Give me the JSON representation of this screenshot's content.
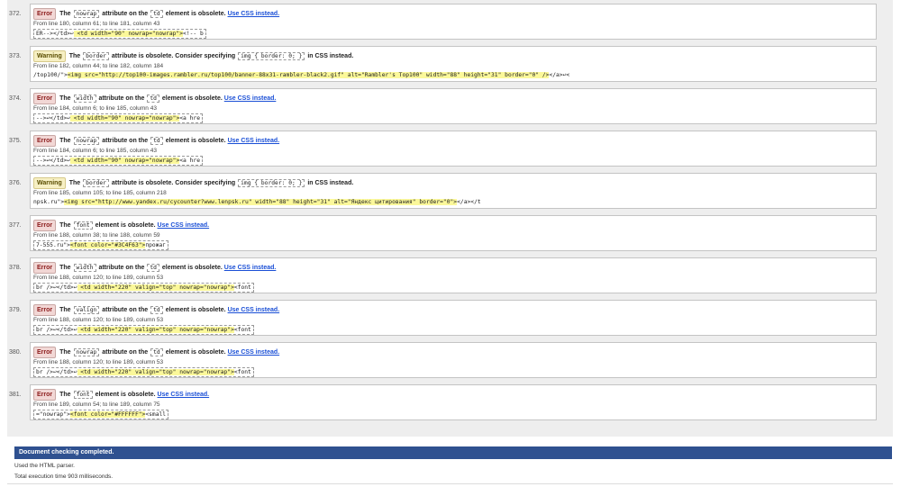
{
  "messages": [
    {
      "num": "372.",
      "type": "error",
      "badge": "Error",
      "pre": "The",
      "code1": "nowrap",
      "mid": "attribute on the",
      "code2": "td",
      "post": "element is obsolete.",
      "link": "Use CSS instead.",
      "location": "From line 180, column 61; to line 181, column 43",
      "extract_before": "ER-->&lt;/td>↩",
      "extract_hl": "            <td width=\"90\" nowrap=\"nowrap\">",
      "extract_after": "<!-- b"
    },
    {
      "num": "373.",
      "type": "warning",
      "badge": "Warning",
      "pre": "The",
      "code1": "border",
      "mid": "attribute is obsolete. Consider specifying",
      "code2": "img { border: 0; }",
      "post": "in CSS instead.",
      "link": "",
      "location": "From line 182, column 44; to line 182, column 184",
      "extract_before": "/top100/\">",
      "extract_hl": "<img src=\"http://top100-images.rambler.ru/top100/banner-88x31-rambler-black2.gif\" alt=\"Rambler's Top100\" width=\"88\" height=\"31\" border=\"0\" />",
      "extract_after": "</a>↩<"
    },
    {
      "num": "374.",
      "type": "error",
      "badge": "Error",
      "pre": "The",
      "code1": "width",
      "mid": "attribute on the",
      "code2": "td",
      "post": "element is obsolete.",
      "link": "Use CSS instead.",
      "location": "From line 184, column 6; to line 185, column 43",
      "extract_before": " -->↩</td>↩",
      "extract_hl": "            <td width=\"90\" nowrap=\"nowrap\">",
      "extract_after": "<a hre"
    },
    {
      "num": "375.",
      "type": "error",
      "badge": "Error",
      "pre": "The",
      "code1": "nowrap",
      "mid": "attribute on the",
      "code2": "td",
      "post": "element is obsolete.",
      "link": "Use CSS instead.",
      "location": "From line 184, column 6; to line 185, column 43",
      "extract_before": " -->↩</td>↩",
      "extract_hl": "            <td width=\"90\" nowrap=\"nowrap\">",
      "extract_after": "<a hre"
    },
    {
      "num": "376.",
      "type": "warning",
      "badge": "Warning",
      "pre": "The",
      "code1": "border",
      "mid": "attribute is obsolete. Consider specifying",
      "code2": "img { border: 0; }",
      "post": "in CSS instead.",
      "link": "",
      "location": "From line 185, column 105; to line 185, column 218",
      "extract_before": "npsk.ru\">",
      "extract_hl": "<img src=\"http://www.yandex.ru/cycounter?www.lenpsk.ru\" width=\"88\" height=\"31\" alt=\"Яндекс цитирования\" border=\"0\">",
      "extract_after": "</a></t"
    },
    {
      "num": "377.",
      "type": "error",
      "badge": "Error",
      "pre": "The",
      "code1": "font",
      "mid": "element is obsolete.",
      "code2": "",
      "post": "",
      "link": "Use CSS instead.",
      "location": "From line 188, column 38; to line 188, column 59",
      "extract_before": "7-555.ru\">",
      "extract_hl": "<font color=\"#3C4F63\">",
      "extract_after": "прожаг"
    },
    {
      "num": "378.",
      "type": "error",
      "badge": "Error",
      "pre": "The",
      "code1": "width",
      "mid": "attribute on the",
      "code2": "td",
      "post": "element is obsolete.",
      "link": "Use CSS instead.",
      "location": "From line 188, column 120; to line 189, column 53",
      "extract_before": "br />↩</td>↩",
      "extract_hl": "          <td width=\"220\" valign=\"top\" nowrap=\"nowrap\">",
      "extract_after": "<font "
    },
    {
      "num": "379.",
      "type": "error",
      "badge": "Error",
      "pre": "The",
      "code1": "valign",
      "mid": "attribute on the",
      "code2": "td",
      "post": "element is obsolete.",
      "link": "Use CSS instead.",
      "location": "From line 188, column 120; to line 189, column 53",
      "extract_before": "br />↩</td>↩",
      "extract_hl": "          <td width=\"220\" valign=\"top\" nowrap=\"nowrap\">",
      "extract_after": "<font "
    },
    {
      "num": "380.",
      "type": "error",
      "badge": "Error",
      "pre": "The",
      "code1": "nowrap",
      "mid": "attribute on the",
      "code2": "td",
      "post": "element is obsolete.",
      "link": "Use CSS instead.",
      "location": "From line 188, column 120; to line 189, column 53",
      "extract_before": "br />↩</td>↩",
      "extract_hl": "          <td width=\"220\" valign=\"top\" nowrap=\"nowrap\">",
      "extract_after": "<font "
    },
    {
      "num": "381.",
      "type": "error",
      "badge": "Error",
      "pre": "The",
      "code1": "font",
      "mid": "element is obsolete.",
      "code2": "",
      "post": "",
      "link": "Use CSS instead.",
      "location": "From line 189, column 54; to line 189, column 75",
      "extract_before": "=\"nowrap\">",
      "extract_hl": "<font color=\"#FFFFFF\">",
      "extract_after": "<small"
    }
  ],
  "footer": {
    "completed": "Document checking completed.",
    "parser": "Used the HTML parser.",
    "time": "Total execution time 903 milliseconds."
  },
  "colors": {
    "error_badge_bg": "#f2d7d5",
    "warning_badge_bg": "#f7f0c4",
    "highlight": "#fbf89a",
    "completed_bar": "#2f5190",
    "link": "#1a4fd6"
  }
}
